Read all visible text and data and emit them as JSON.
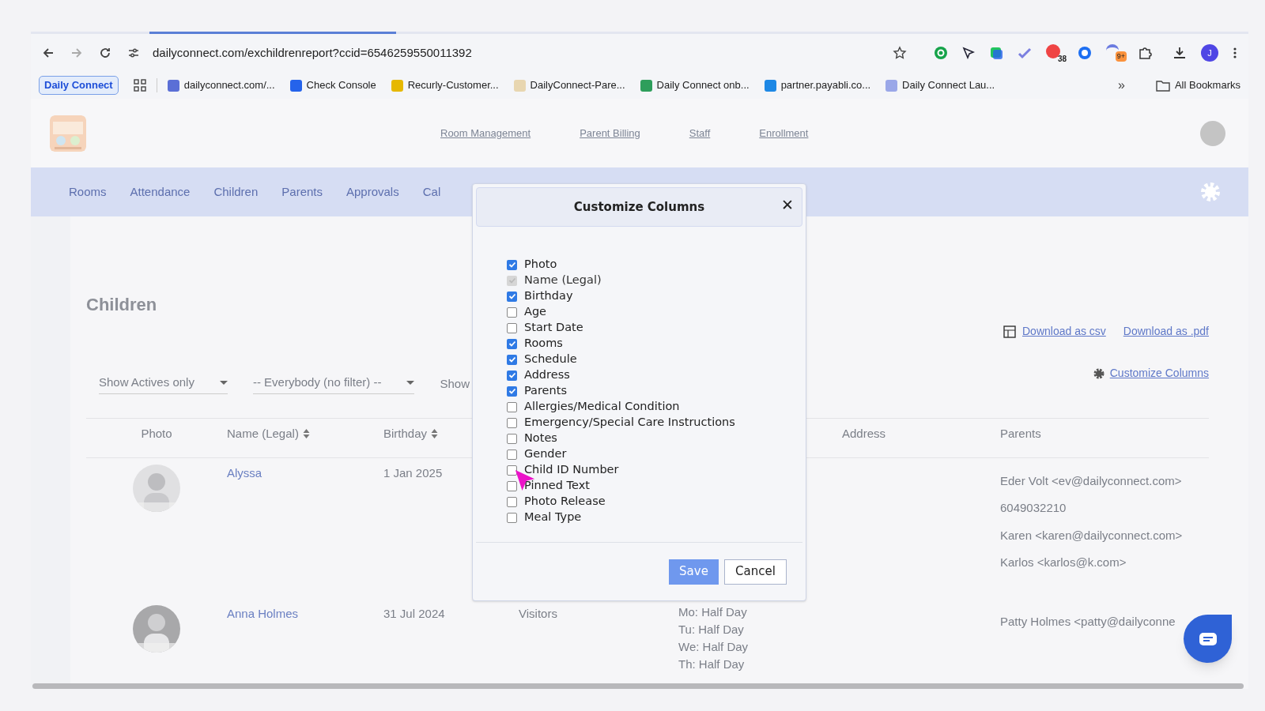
{
  "browser": {
    "url": "dailyconnect.com/exchildrenreport?ccid=6546259550011392",
    "extension_badges": [
      "38",
      "9+"
    ],
    "profile_initial": "J",
    "bookmarks": [
      {
        "kind": "pill",
        "label": "Daily Connect"
      },
      {
        "kind": "apps"
      },
      {
        "kind": "link",
        "label": "dailyconnect.com/...",
        "color": "#5b6fd6"
      },
      {
        "kind": "link",
        "label": "Check Console",
        "color": "#2563eb"
      },
      {
        "kind": "link",
        "label": "Recurly-Customer...",
        "color": "#e6b800"
      },
      {
        "kind": "link",
        "label": "DailyConnect-Pare...",
        "color": "#e8d6b0"
      },
      {
        "kind": "link",
        "label": "Daily Connect onb...",
        "color": "#2e9e5b"
      },
      {
        "kind": "link",
        "label": "partner.payabli.co...",
        "color": "#1e88e5"
      },
      {
        "kind": "link",
        "label": "Daily Connect Lau...",
        "color": "#9aa7e8"
      }
    ],
    "overflow": "»",
    "all_bookmarks": "All Bookmarks"
  },
  "header": {
    "links": [
      "Room Management",
      "Parent Billing",
      "Staff",
      "Enrollment"
    ]
  },
  "nav": {
    "items": [
      "Rooms",
      "Attendance",
      "Children",
      "Parents",
      "Approvals",
      "Cal"
    ]
  },
  "page": {
    "title": "Children",
    "downloads": [
      "Download as csv",
      "Download as .pdf"
    ],
    "customize_link": "Customize Columns",
    "filters": [
      {
        "kind": "select",
        "label": "Show Actives only"
      },
      {
        "kind": "select",
        "label": "-- Everybody (no filter) --"
      },
      {
        "kind": "text",
        "label": "Show"
      }
    ],
    "table": {
      "columns": [
        {
          "label": "Photo",
          "sortable": false
        },
        {
          "label": "Name (Legal)",
          "sortable": true
        },
        {
          "label": "Birthday",
          "sortable": true
        },
        {
          "label": "Address",
          "sortable": false
        },
        {
          "label": "Parents",
          "sortable": false
        }
      ],
      "rows": [
        {
          "name": "Alyssa",
          "birthday": "1 Jan 2025",
          "rooms": "",
          "schedule": [],
          "parents": [
            "Eder Volt <ev@dailyconnect.com>",
            "6049032210",
            "Karen <karen@dailyconnect.com>",
            "Karlos <karlos@k.com>"
          ]
        },
        {
          "name": "Anna Holmes",
          "birthday": "31 Jul 2024",
          "rooms": "Visitors",
          "schedule": [
            "Mo: Half Day",
            "Tu: Half Day",
            "We: Half Day",
            "Th: Half Day"
          ],
          "parents": [
            "Patty Holmes <patty@dailyconne"
          ]
        }
      ]
    }
  },
  "dialog": {
    "title": "Customize Columns",
    "close": "✕",
    "options": [
      {
        "label": "Photo",
        "checked": true,
        "disabled": false
      },
      {
        "label": "Name (Legal)",
        "checked": true,
        "disabled": true
      },
      {
        "label": "Birthday",
        "checked": true,
        "disabled": false
      },
      {
        "label": "Age",
        "checked": false,
        "disabled": false
      },
      {
        "label": "Start Date",
        "checked": false,
        "disabled": false
      },
      {
        "label": "Rooms",
        "checked": true,
        "disabled": false
      },
      {
        "label": "Schedule",
        "checked": true,
        "disabled": false
      },
      {
        "label": "Address",
        "checked": true,
        "disabled": false
      },
      {
        "label": "Parents",
        "checked": true,
        "disabled": false
      },
      {
        "label": "Allergies/Medical Condition",
        "checked": false,
        "disabled": false
      },
      {
        "label": "Emergency/Special Care Instructions",
        "checked": false,
        "disabled": false
      },
      {
        "label": "Notes",
        "checked": false,
        "disabled": false
      },
      {
        "label": "Gender",
        "checked": false,
        "disabled": false
      },
      {
        "label": "Child ID Number",
        "checked": false,
        "disabled": false
      },
      {
        "label": "Pinned Text",
        "checked": false,
        "disabled": false
      },
      {
        "label": "Photo Release",
        "checked": false,
        "disabled": false
      },
      {
        "label": "Meal Type",
        "checked": false,
        "disabled": false
      }
    ],
    "buttons": [
      "Save",
      "Cancel"
    ]
  }
}
